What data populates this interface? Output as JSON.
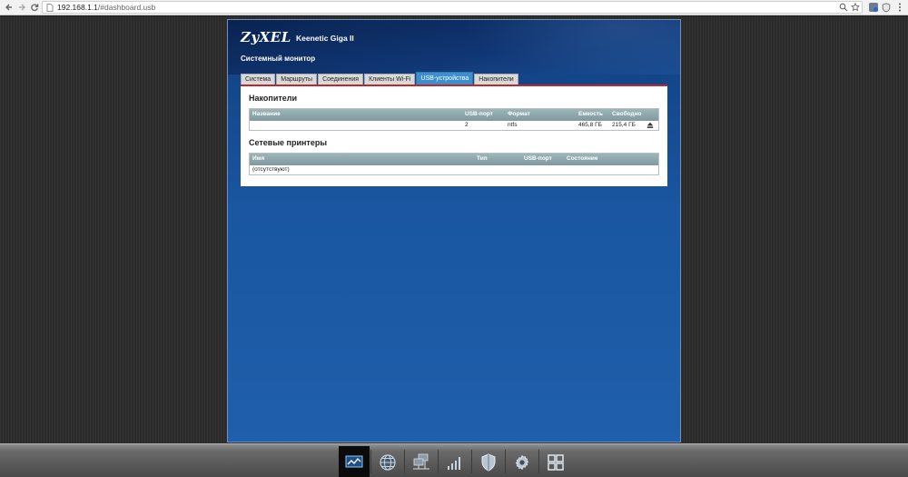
{
  "browser": {
    "url_host": "192.168.1.1",
    "url_path": "/#dashboard.usb"
  },
  "app": {
    "logo": "ZyXEL",
    "model": "Keenetic Giga II",
    "title": "Системный монитор"
  },
  "tabs": [
    {
      "label": "Система",
      "active": false
    },
    {
      "label": "Маршруты",
      "active": false
    },
    {
      "label": "Соединения",
      "active": false
    },
    {
      "label": "Клиенты Wi-Fi",
      "active": false
    },
    {
      "label": "USB-устройства",
      "active": true
    },
    {
      "label": "Накопители",
      "active": false
    }
  ],
  "drives": {
    "title": "Накопители",
    "headers": [
      "Название",
      "USB-порт",
      "Формат",
      "Емкость",
      "Свободно"
    ],
    "rows": [
      {
        "name": "",
        "port": "2",
        "format": "ntfs",
        "capacity": "465,8 ГБ",
        "free": "215,4 ГБ"
      }
    ]
  },
  "printers": {
    "title": "Сетевые принтеры",
    "headers": [
      "Имя",
      "Тип",
      "USB-порт",
      "Состояние"
    ],
    "empty": "(отсутствуют)"
  },
  "taskbar": {
    "items": [
      "monitor-icon",
      "internet-globe-icon",
      "network-icon",
      "wifi-signal-icon",
      "security-shield-icon",
      "settings-gear-icon",
      "apps-grid-icon"
    ],
    "active_index": 0
  },
  "colors": {
    "accent": "#3c8fcb",
    "tab_underline": "#c0272d",
    "app_bg": "#1a56a2",
    "table_header": "#8ea8ad"
  }
}
